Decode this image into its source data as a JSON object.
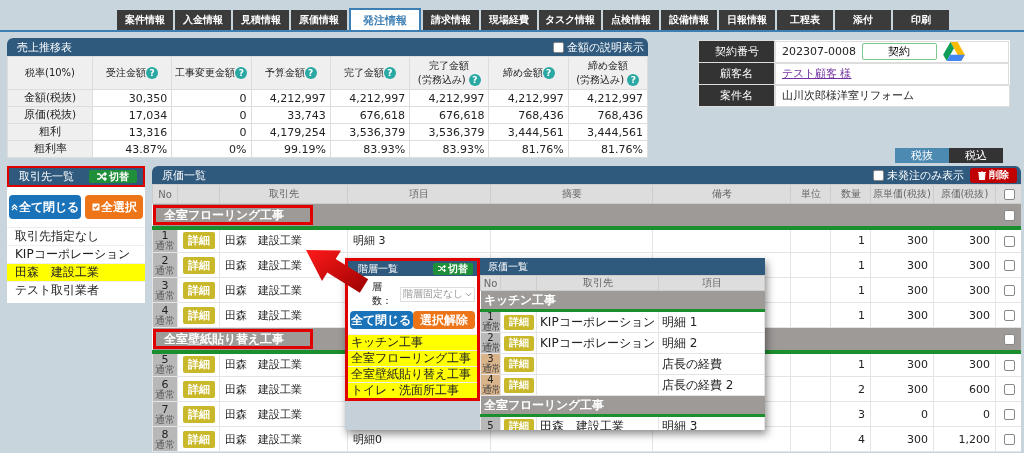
{
  "tabs": [
    {
      "label": "案件情報",
      "selected": false
    },
    {
      "label": "入金情報",
      "selected": false
    },
    {
      "label": "見積情報",
      "selected": false
    },
    {
      "label": "原価情報",
      "selected": false
    },
    {
      "label": "発注情報",
      "selected": true
    },
    {
      "label": "請求情報",
      "selected": false
    },
    {
      "label": "現場経費",
      "selected": false
    },
    {
      "label": "タスク情報",
      "selected": false
    },
    {
      "label": "点検情報",
      "selected": false
    },
    {
      "label": "設備情報",
      "selected": false
    },
    {
      "label": "日報情報",
      "selected": false
    },
    {
      "label": "工程表",
      "selected": false
    },
    {
      "label": "添付",
      "selected": false
    },
    {
      "label": "印刷",
      "selected": false
    }
  ],
  "sales": {
    "title": "売上推移表",
    "toggle": {
      "label": "金額の説明表示",
      "checked": false
    },
    "corner": "税率(10%)",
    "columns": [
      {
        "label": "受注金額",
        "help": "?"
      },
      {
        "label": "工事変更金額",
        "help": "?"
      },
      {
        "label": "予算金額",
        "help": "?"
      },
      {
        "label": "完了金額",
        "help": "?"
      },
      {
        "label": "完了金額",
        "sub": "(労務込み)",
        "help": "?"
      },
      {
        "label": "締め金額",
        "help": "?"
      },
      {
        "label": "締め金額",
        "sub": "(労務込み)",
        "help": "?"
      }
    ],
    "rows": [
      {
        "label": "金額(税抜)",
        "values": [
          "30,350",
          "0",
          "4,212,997",
          "4,212,997",
          "4,212,997",
          "4,212,997",
          "4,212,997"
        ]
      },
      {
        "label": "原価(税抜)",
        "values": [
          "17,034",
          "0",
          "33,743",
          "676,618",
          "676,618",
          "768,436",
          "768,436"
        ]
      },
      {
        "label": "粗利",
        "values": [
          "13,316",
          "0",
          "4,179,254",
          "3,536,379",
          "3,536,379",
          "3,444,561",
          "3,444,561"
        ]
      },
      {
        "label": "粗利率",
        "values": [
          "43.87%",
          "0%",
          "99.19%",
          "83.93%",
          "83.93%",
          "81.76%",
          "81.76%"
        ]
      }
    ]
  },
  "contract": {
    "rows": [
      {
        "label": "契約番号",
        "value": "202307-0008",
        "kind": "number",
        "button": "契約"
      },
      {
        "label": "顧客名",
        "value": "テスト顧客 様",
        "kind": "link"
      },
      {
        "label": "案件名",
        "value": "山川次郎様洋室リフォーム",
        "kind": "text"
      }
    ]
  },
  "tax_modes": [
    {
      "label": "税抜",
      "selected": true
    },
    {
      "label": "税込",
      "selected": false
    }
  ],
  "vendors": {
    "title": "取引先一覧",
    "switch": "切替",
    "highlighted": true,
    "buttons": [
      {
        "label": "全て閉じる",
        "kind": "collapse"
      },
      {
        "label": "全選択",
        "kind": "select"
      }
    ],
    "items": [
      {
        "label": "取引先指定なし",
        "selected": false
      },
      {
        "label": "KIPコーポレーション",
        "selected": false
      },
      {
        "label": "田森　建設工業",
        "selected": true
      },
      {
        "label": "テスト取引業者",
        "selected": false
      }
    ]
  },
  "costs": {
    "title": "原価一覧",
    "filter": {
      "label": "未発注のみ表示",
      "checked": false
    },
    "delete": "削除",
    "columns": [
      "No",
      "取引先",
      "項目",
      "摘要",
      "備考",
      "単位",
      "数量",
      "原単価(税抜)",
      "原価(税抜)"
    ],
    "all_checked": false,
    "groups": [
      {
        "name": "全室フローリング工事",
        "highlighted": true,
        "checked": false,
        "rows": [
          {
            "no": "1",
            "type": "通常",
            "detail": "詳細",
            "vendor": "田森　建設工業",
            "item": "明細 3",
            "qty": "1",
            "unit_price": "300",
            "cost": "300",
            "checked": false
          },
          {
            "no": "2",
            "type": "通常",
            "detail": "詳細",
            "vendor": "田森　建設工業",
            "qty": "1",
            "unit_price": "300",
            "cost": "300",
            "checked": false
          },
          {
            "no": "3",
            "type": "通常",
            "detail": "詳細",
            "vendor": "田森　建設工業",
            "qty": "1",
            "unit_price": "300",
            "cost": "300",
            "checked": false
          },
          {
            "no": "4",
            "type": "通常",
            "detail": "詳細",
            "vendor": "田森　建設工業",
            "qty": "1",
            "unit_price": "300",
            "cost": "300",
            "checked": false
          }
        ]
      },
      {
        "name": "全室壁紙貼り替え工事",
        "highlighted": true,
        "checked": false,
        "rows": [
          {
            "no": "5",
            "type": "通常",
            "detail": "詳細",
            "vendor": "田森　建設工業",
            "qty": "1",
            "unit_price": "300",
            "cost": "300",
            "checked": false
          },
          {
            "no": "6",
            "type": "通常",
            "detail": "詳細",
            "vendor": "田森　建設工業",
            "qty": "2",
            "unit_price": "300",
            "cost": "600",
            "checked": false
          },
          {
            "no": "7",
            "type": "通常",
            "detail": "詳細",
            "vendor": "田森　建設工業",
            "qty": "3",
            "unit_price": "0",
            "cost": "0",
            "checked": false
          },
          {
            "no": "8",
            "type": "通常",
            "detail": "詳細",
            "vendor": "田森　建設工業",
            "item": "明細0",
            "qty": "4",
            "unit_price": "300",
            "cost": "1,200",
            "checked": false
          }
        ]
      }
    ]
  },
  "inset": {
    "levels": {
      "title": "階層一覧",
      "switch": "切替",
      "highlighted": true,
      "depth_label": "層数：",
      "depth_value": "階層固定なし",
      "buttons": [
        {
          "label": "全て閉じる",
          "kind": "collapse"
        },
        {
          "label": "選択解除",
          "kind": "clear"
        }
      ],
      "items": [
        {
          "label": "キッチン工事",
          "selected": true
        },
        {
          "label": "全室フローリング工事",
          "selected": true
        },
        {
          "label": "全室壁紙貼り替え工事",
          "selected": true
        },
        {
          "label": "トイレ・洗面所工事",
          "selected": true
        }
      ]
    },
    "costs": {
      "title": "原価一覧",
      "columns": [
        "No",
        "取引先",
        "項目"
      ],
      "groups": [
        {
          "name": "キッチン工事",
          "rows": [
            {
              "no": "1",
              "type": "通常",
              "detail": "詳細",
              "vendor": "KIPコーポレーション",
              "item": "明細 1",
              "tinted": false
            },
            {
              "no": "2",
              "type": "通常",
              "detail": "詳細",
              "vendor": "KIPコーポレーション",
              "item": "明細 2",
              "tinted": false
            },
            {
              "no": "3",
              "type": "通常",
              "detail": "詳細",
              "item": "店長の経費",
              "tinted": true
            },
            {
              "no": "4",
              "type": "通常",
              "detail": "詳細",
              "item": "店長の経費 2",
              "tinted": true
            }
          ]
        },
        {
          "name": "全室フローリング工事",
          "rows": [
            {
              "no": "5",
              "detail": "詳細",
              "vendor": "田森　建設工業",
              "item": "明細 3",
              "tinted": false
            }
          ]
        }
      ]
    }
  }
}
